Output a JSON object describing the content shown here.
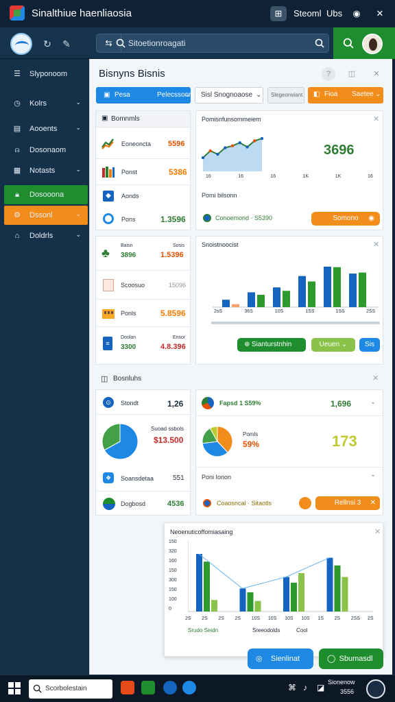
{
  "app": {
    "title": "Sinalthiue haenliaosia"
  },
  "titlebar": {
    "user": "Steoml",
    "lang": "Ubs"
  },
  "search": {
    "scope": "⇆",
    "placeholder": "Sitoetionroagati"
  },
  "sidebar": {
    "items": [
      {
        "label": "Slyponoom",
        "icon": "menu-icon",
        "chev": ""
      },
      {
        "label": "Kolrs",
        "icon": "clock-icon",
        "chev": "⌄"
      },
      {
        "label": "Aooents",
        "icon": "clipboard-icon",
        "chev": "⌄"
      },
      {
        "label": "Dosonaom",
        "icon": "person-icon",
        "chev": ""
      },
      {
        "label": "Notasts",
        "icon": "list-icon",
        "chev": "⌄"
      },
      {
        "label": "Dosooona",
        "icon": "lock-icon",
        "chev": ""
      },
      {
        "label": "Dssonl",
        "icon": "gear-icon",
        "chev": "⌄"
      },
      {
        "label": "Doldrls",
        "icon": "chat-icon",
        "chev": "⌄"
      }
    ]
  },
  "main": {
    "title": "Bisnyns Bisnis"
  },
  "filters": {
    "primary": "Pelecssonno",
    "primary_lead": "Pesa",
    "secondary": "Sisl Snognoaose",
    "tertiary": "Slegeorwiant",
    "orange": "Saetee",
    "orange_lead": "Fioa"
  },
  "panel_left": {
    "title": "Bomnmls",
    "rows": [
      {
        "label": "Eoneoncta",
        "value": "5596"
      },
      {
        "label": "Ponst",
        "value": "5386"
      },
      {
        "label": "Aonds",
        "value": ""
      },
      {
        "label": "Pons",
        "value": "1.3596"
      }
    ]
  },
  "panel_trend": {
    "title": "Pomisnfunsommeiem",
    "big_value": "3696",
    "x_ticks": [
      "16",
      "16",
      "16",
      "1K",
      "1K",
      "16"
    ],
    "note": "Pomi bilsonn",
    "status": "Conoemond · S5390",
    "button": "Somono"
  },
  "panel_left2": {
    "rows": [
      {
        "label": "Baisn",
        "sub": "3896",
        "tag": "Sosis",
        "value": "1.5396"
      },
      {
        "label": "Scoosuo",
        "sub": "",
        "tag": "",
        "value": "15096"
      },
      {
        "label": "Ponls",
        "sub": "",
        "tag": "",
        "value": "5.8596"
      },
      {
        "label": "Doolan",
        "sub": "3300",
        "tag": "Ensor",
        "value": "4.8.396"
      }
    ]
  },
  "panel_bar": {
    "title": "Snoistnoocist",
    "x_ticks": [
      "2sS",
      "36S",
      "10S",
      "1SS",
      "1SS",
      "2SS"
    ],
    "btn_green": "Sianturstnhin",
    "btn_lime": "Ueuen",
    "btn_blue": "Sis"
  },
  "section": {
    "title": "Bosnluhs"
  },
  "panel_bottom_left": {
    "rows": [
      {
        "label": "Stondt",
        "value": "1,26"
      },
      {
        "label": "Suoad ssbols",
        "value": "$13.500"
      },
      {
        "label": "Soansdetaa",
        "value": "551"
      },
      {
        "label": "Dogbosd",
        "value": "4536"
      }
    ]
  },
  "panel_bottom_right": {
    "top_label": "Fapsd 1 S59%",
    "top_value": "1,696",
    "pie_label": "Pomls",
    "pie_pct": "59%",
    "big_value": "173",
    "note": "Poni Ionon",
    "status": "Coaosncal · Sitaotls",
    "button": "Rellnsi 3"
  },
  "panel_chart": {
    "title": "Neoenuticoffomiasaing",
    "y_ticks": [
      "150",
      "320",
      "160",
      "150",
      "300",
      "150",
      "100",
      "0"
    ],
    "x_ticks": [
      "2S",
      "2S",
      "2S",
      "2S",
      "10S",
      "10S",
      "10S",
      "10S",
      "1S",
      "2S",
      "2SS",
      "2S"
    ],
    "labels": [
      "Srudo Seidn",
      "Sreeodolds",
      "Cool"
    ]
  },
  "fab": {
    "primary": "Sienlinat",
    "secondary": "Sbumasdl"
  },
  "taskbar": {
    "search": "Scorbolestain",
    "clock_time": "Sionenow",
    "clock_date": "3556"
  },
  "chart_data": [
    {
      "type": "line",
      "title": "Pomisnfunsommeiem",
      "x": [
        "16",
        "16",
        "16",
        "1K",
        "1K",
        "16"
      ],
      "series": [
        {
          "name": "Series 1",
          "values": [
            3.2,
            5.0,
            4.1,
            5.8,
            6.3,
            7.1,
            6.0,
            7.6,
            8.2
          ]
        }
      ],
      "ylim": [
        0,
        10
      ]
    },
    {
      "type": "bar",
      "title": "Snoistnoocist",
      "categories": [
        "2sS",
        "36S",
        "10S",
        "1SS",
        "1SS",
        "2SS"
      ],
      "series": [
        {
          "name": "Blue",
          "values": [
            1.5,
            3.0,
            4.0,
            6.3,
            8.2,
            6.8
          ]
        },
        {
          "name": "Green",
          "values": [
            0.6,
            2.5,
            3.3,
            5.2,
            8.1,
            7.0
          ]
        }
      ],
      "ylim": [
        0,
        10
      ]
    },
    {
      "type": "pie",
      "values": [
        67,
        33
      ]
    },
    {
      "type": "pie",
      "values": [
        38,
        35,
        19,
        8
      ]
    },
    {
      "type": "bar",
      "title": "Neoenuticoffomiasaing",
      "categories": [
        "2S",
        "10S",
        "1S",
        "2S"
      ],
      "series": [
        {
          "name": "Blue",
          "values": [
            300,
            120,
            180,
            280
          ]
        },
        {
          "name": "Green",
          "values": [
            260,
            100,
            150,
            240
          ]
        },
        {
          "name": "Lime",
          "values": [
            60,
            55,
            200,
            180
          ]
        }
      ],
      "ylim": [
        0,
        350
      ]
    }
  ]
}
